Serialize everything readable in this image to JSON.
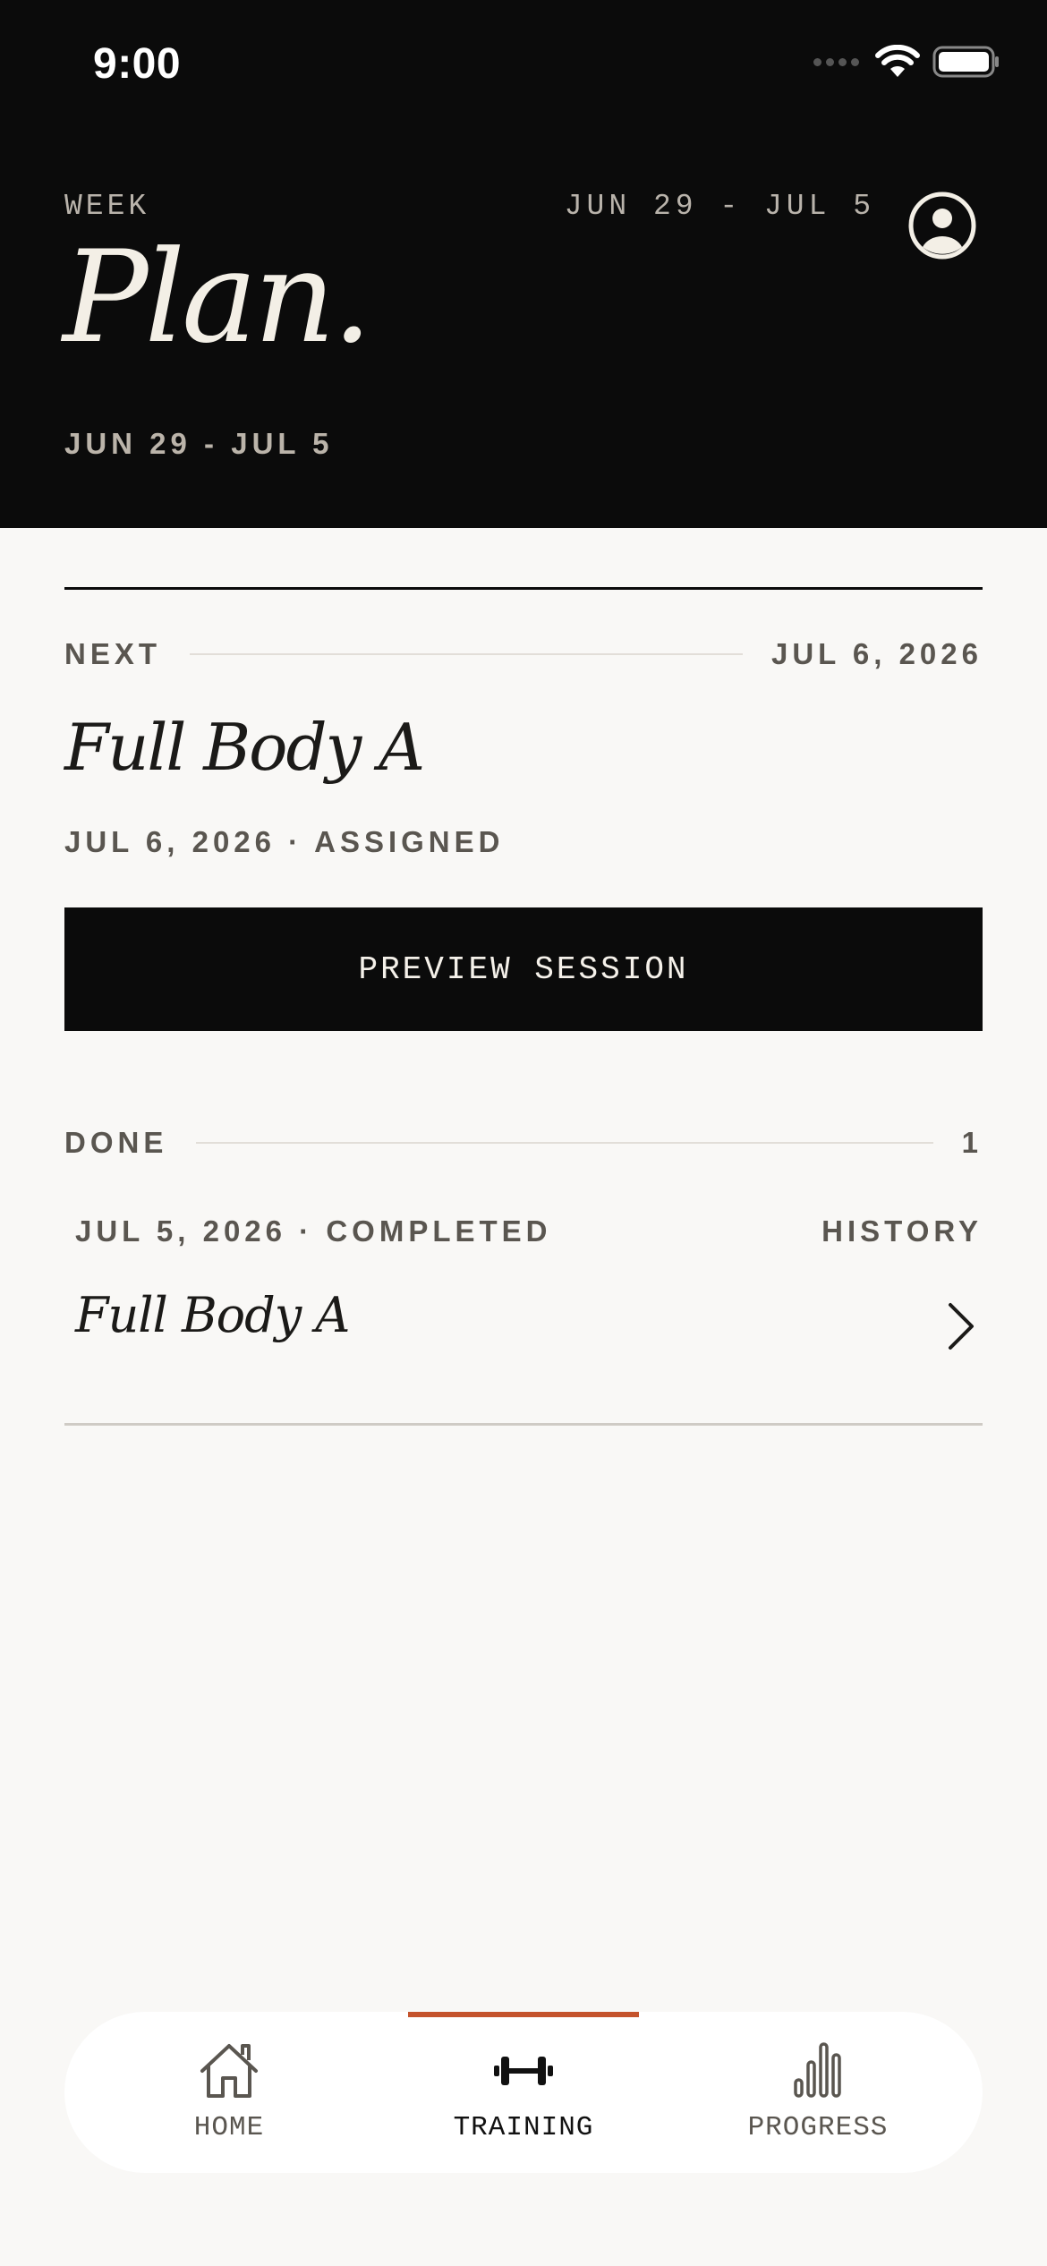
{
  "status_bar": {
    "time": "9:00"
  },
  "header": {
    "week_label": "WEEK",
    "week_range": "JUN 29 - JUL 5",
    "title": "Plan.",
    "subtitle_range": "JUN 29 - JUL 5"
  },
  "next_section": {
    "label": "NEXT",
    "date": "JUL 6, 2026",
    "session_title": "Full Body A",
    "meta": "JUL 6, 2026 · ASSIGNED",
    "button_label": "PREVIEW SESSION"
  },
  "done_section": {
    "label": "DONE",
    "count": "1",
    "items": [
      {
        "meta": "JUL 5, 2026 · COMPLETED",
        "link_label": "HISTORY",
        "title": "Full Body A"
      }
    ]
  },
  "tabbar": {
    "tabs": [
      {
        "label": "HOME",
        "icon": "house-icon"
      },
      {
        "label": "TRAINING",
        "icon": "dumbbell-icon",
        "active": true
      },
      {
        "label": "PROGRESS",
        "icon": "bar-chart-icon"
      }
    ]
  },
  "colors": {
    "accent": "#c4532c",
    "header_bg": "#0b0b0b",
    "page_bg": "#f9f8f6"
  }
}
